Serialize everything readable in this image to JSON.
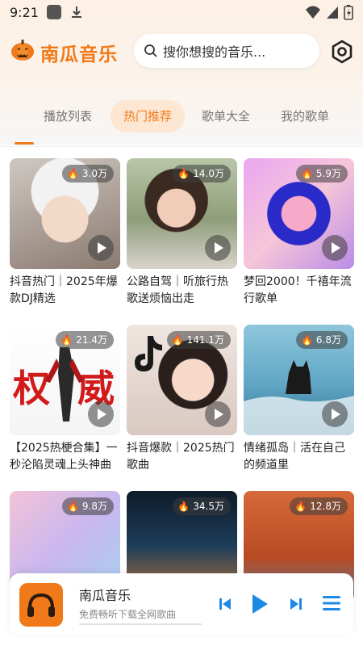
{
  "status_bar": {
    "time": "9:21"
  },
  "header": {
    "app_name": "南瓜音乐",
    "search_placeholder": "搜你想搜的音乐..."
  },
  "tabs": [
    {
      "label": "播放列表",
      "active": false
    },
    {
      "label": "热门推荐",
      "active": true
    },
    {
      "label": "歌单大全",
      "active": false
    },
    {
      "label": "我的歌单",
      "active": false
    }
  ],
  "playlists": [
    {
      "plays": "3.0万",
      "title": "抖音热门｜2025年爆款DJ精选"
    },
    {
      "plays": "14.0万",
      "title": "公路自驾｜听旅行热歌送烦恼出走"
    },
    {
      "plays": "5.9万",
      "title": "梦回2000！千禧年流行歌单"
    },
    {
      "plays": "21.4万",
      "title": "【2025热梗合集】一秒沦陷灵魂上头神曲"
    },
    {
      "plays": "141.1万",
      "title": "抖音爆款｜2025热门歌曲"
    },
    {
      "plays": "6.8万",
      "title": "情绪孤岛｜活在自己的频道里"
    },
    {
      "plays": "9.8万",
      "title": ""
    },
    {
      "plays": "34.5万",
      "title": ""
    },
    {
      "plays": "12.8万",
      "title": ""
    }
  ],
  "player": {
    "title": "南瓜音乐",
    "subtitle": "免费畅听下载全网歌曲",
    "progress": 0.0
  },
  "colors": {
    "accent": "#f07a1a",
    "tab_active_bg": "#fde6d2"
  }
}
